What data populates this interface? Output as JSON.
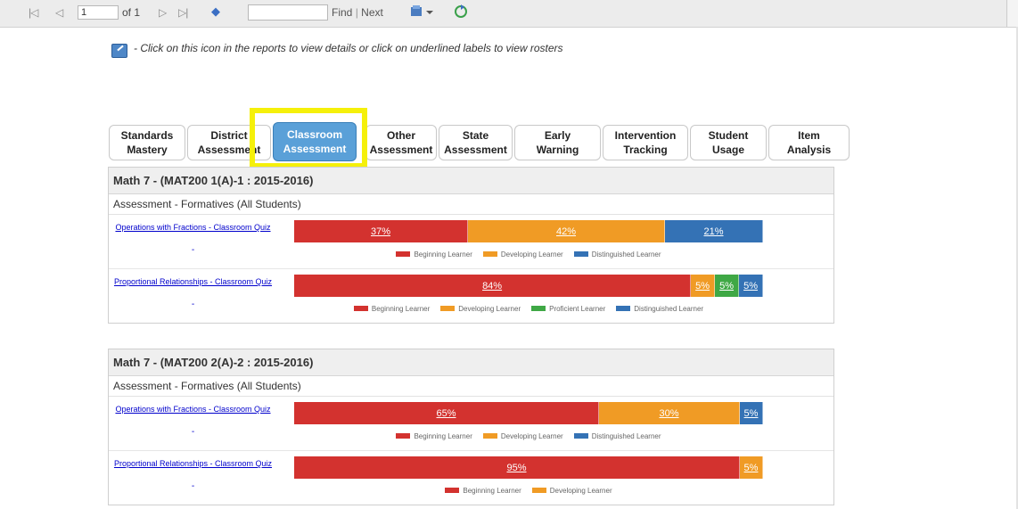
{
  "colors": {
    "beginning": "#d3322f",
    "developing": "#f09b25",
    "proficient": "#3fa845",
    "distinguished": "#3472b5"
  },
  "toolbar": {
    "first_icon": "first-page-icon",
    "prev_icon": "previous-page-icon",
    "page_value": "1",
    "of_label": "of 1",
    "next_icon": "next-page-icon",
    "last_icon": "last-page-icon",
    "back_icon": "back-icon",
    "find_label": "Find",
    "separator": "|",
    "next_label": "Next",
    "export_icon": "export-icon",
    "refresh_icon": "refresh-icon"
  },
  "info": {
    "icon": "details-icon",
    "text": "- Click on this icon in the reports to view details or click on underlined labels to view rosters"
  },
  "tabs": [
    {
      "line1": "Standards",
      "line2": "Mastery",
      "active": false
    },
    {
      "line1": "District",
      "line2": "Assessment",
      "active": false
    },
    {
      "line1": "Classroom",
      "line2": "Assessment",
      "active": true
    },
    {
      "line1": "Other",
      "line2": "Assessment",
      "active": false
    },
    {
      "line1": "State",
      "line2": "Assessment",
      "active": false
    },
    {
      "line1": "Early",
      "line2": "Warning",
      "active": false
    },
    {
      "line1": "Intervention",
      "line2": "Tracking",
      "active": false
    },
    {
      "line1": "Student",
      "line2": "Usage",
      "active": false
    },
    {
      "line1": "Item",
      "line2": "Analysis",
      "active": false
    }
  ],
  "panels": [
    {
      "title": "Math 7 - (MAT200 1(A)-1 : 2015-2016)",
      "subtitle": "Assessment - Formatives (All Students)",
      "rows": [
        {
          "link": "Operations with Fractions - Classroom Quiz",
          "dash": "-",
          "segments": [
            {
              "label": "37%",
              "value": 37,
              "level": "beginning"
            },
            {
              "label": "42%",
              "value": 42,
              "level": "developing"
            },
            {
              "label": "21%",
              "value": 21,
              "level": "distinguished"
            }
          ],
          "legend": [
            {
              "label": "Beginning Learner",
              "level": "beginning"
            },
            {
              "label": "Developing Learner",
              "level": "developing"
            },
            {
              "label": "Distinguished Learner",
              "level": "distinguished"
            }
          ]
        },
        {
          "link": "Proportional Relationships - Classroom Quiz",
          "dash": "-",
          "segments": [
            {
              "label": "84%",
              "value": 84,
              "level": "beginning"
            },
            {
              "label": "5%",
              "value": 5,
              "level": "developing"
            },
            {
              "label": "5%",
              "value": 5,
              "level": "proficient"
            },
            {
              "label": "5%",
              "value": 5,
              "level": "distinguished"
            }
          ],
          "legend": [
            {
              "label": "Beginning Learner",
              "level": "beginning"
            },
            {
              "label": "Developing Learner",
              "level": "developing"
            },
            {
              "label": "Proficient Learner",
              "level": "proficient"
            },
            {
              "label": "Distinguished Learner",
              "level": "distinguished"
            }
          ]
        }
      ]
    },
    {
      "title": "Math 7 - (MAT200 2(A)-2 : 2015-2016)",
      "subtitle": "Assessment - Formatives (All Students)",
      "rows": [
        {
          "link": "Operations with Fractions - Classroom Quiz",
          "dash": "-",
          "segments": [
            {
              "label": "65%",
              "value": 65,
              "level": "beginning"
            },
            {
              "label": "30%",
              "value": 30,
              "level": "developing"
            },
            {
              "label": "5%",
              "value": 5,
              "level": "distinguished"
            }
          ],
          "legend": [
            {
              "label": "Beginning Learner",
              "level": "beginning"
            },
            {
              "label": "Developing Learner",
              "level": "developing"
            },
            {
              "label": "Distinguished Learner",
              "level": "distinguished"
            }
          ]
        },
        {
          "link": "Proportional Relationships - Classroom Quiz",
          "dash": "-",
          "segments": [
            {
              "label": "95%",
              "value": 95,
              "level": "beginning"
            },
            {
              "label": "5%",
              "value": 5,
              "level": "developing"
            }
          ],
          "legend": [
            {
              "label": "Beginning Learner",
              "level": "beginning"
            },
            {
              "label": "Developing Learner",
              "level": "developing"
            }
          ]
        }
      ]
    }
  ]
}
